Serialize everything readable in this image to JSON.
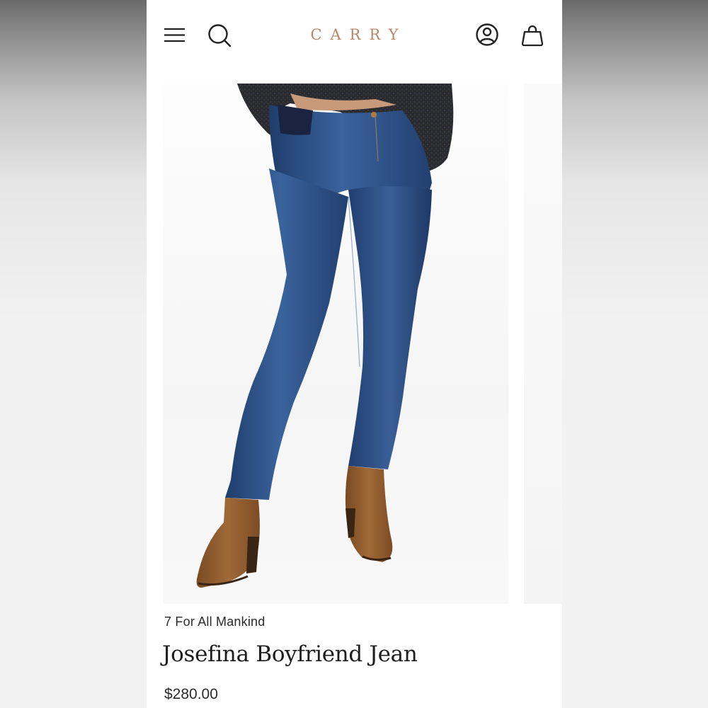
{
  "header": {
    "logo_text": "CARRY",
    "logo_color": "#b5876a",
    "icons": [
      "menu-icon",
      "search-icon",
      "account-icon",
      "shopping-bag-icon"
    ]
  },
  "product": {
    "brand": "7 For All Mankind",
    "title": "Josefina Boyfriend Jean",
    "price": "$280.00",
    "image_alt": "Model wearing dark-wash skinny maternity jeans with tan suede ankle boots"
  },
  "colors": {
    "denim": "#2c4f86",
    "boots": "#8e5a2b",
    "sweater": "#2a2b30"
  }
}
